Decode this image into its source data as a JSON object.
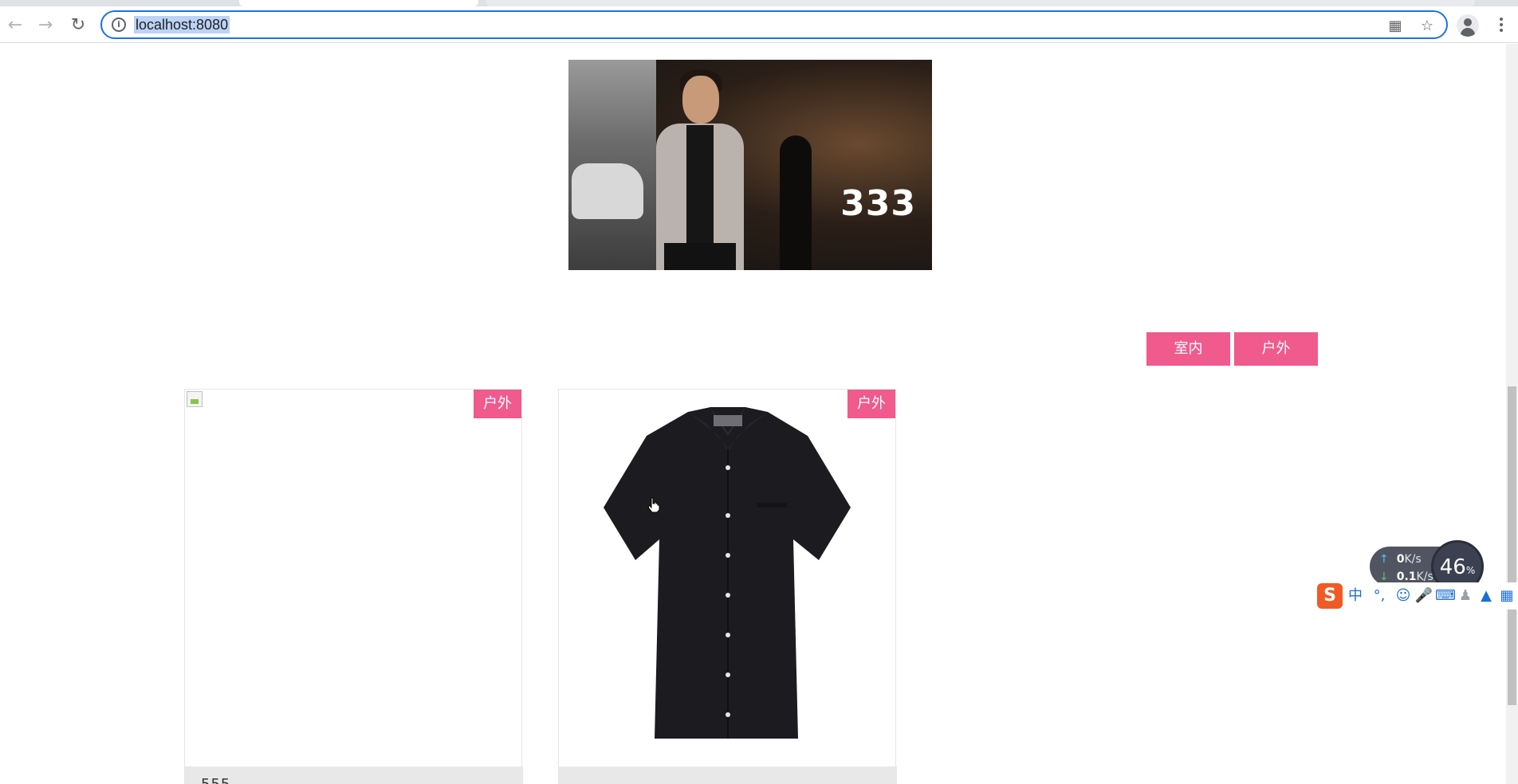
{
  "browser": {
    "url": "localhost:8080",
    "icons": {
      "back": "back-arrow-icon",
      "forward": "forward-arrow-icon",
      "reload": "reload-icon",
      "site_info": "info-icon",
      "qr": "qr-code-icon",
      "bookmark": "star-icon",
      "profile": "profile-icon",
      "menu": "kebab-menu-icon"
    }
  },
  "hero": {
    "caption": "333"
  },
  "filters": {
    "indoor": "室内",
    "outdoor": "户外",
    "accent_color": "#f05a8c"
  },
  "products": [
    {
      "badge": "户外",
      "title": "555",
      "image": "broken-image-icon"
    },
    {
      "badge": "户外",
      "title": "",
      "image": "black-shirt"
    }
  ],
  "overlays": {
    "speed_up": "0",
    "speed_up_unit": "K/s",
    "speed_down": "0.1",
    "speed_down_unit": "K/s",
    "cpu_percent": "46",
    "cpu_unit": "%",
    "ime_logo": "S",
    "ime_mode": "中",
    "ime_punct": "°,"
  }
}
